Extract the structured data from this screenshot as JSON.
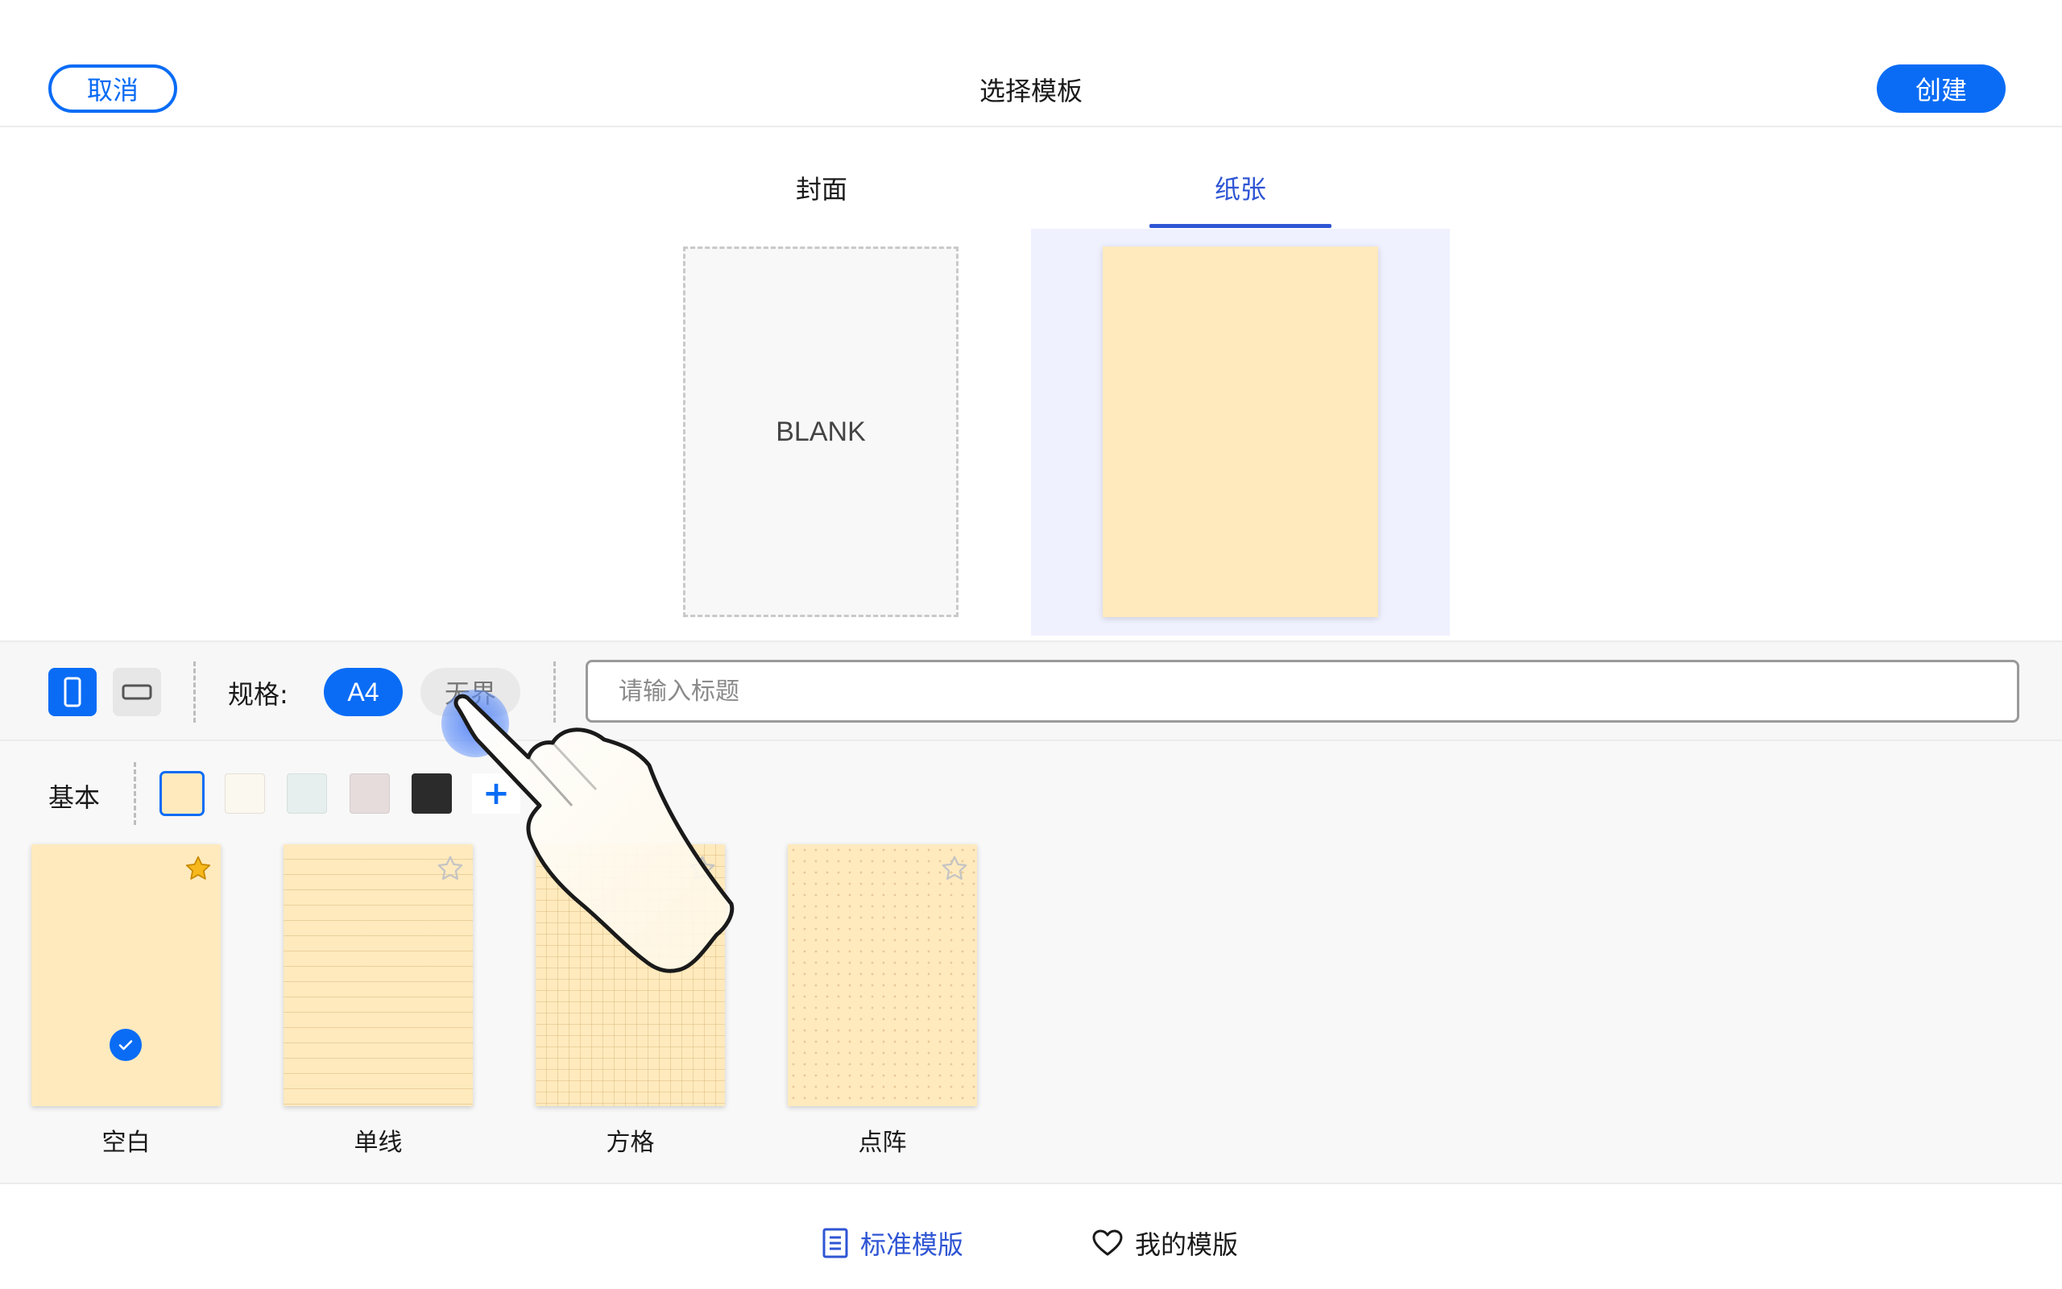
{
  "header": {
    "cancel_label": "取消",
    "title": "选择模板",
    "create_label": "创建"
  },
  "tabs": [
    {
      "label": "封面",
      "active": false
    },
    {
      "label": "纸张",
      "active": true
    }
  ],
  "preview": {
    "cover_text": "BLANK"
  },
  "toolbar": {
    "spec_label": "规格:",
    "sizes": [
      {
        "label": "A4",
        "selected": true
      },
      {
        "label": "无界",
        "selected": false
      }
    ],
    "title_placeholder": "请输入标题",
    "title_value": ""
  },
  "basic": {
    "label": "基本",
    "swatches": [
      "#ffeabe",
      "#fbf8f0",
      "#e6efee",
      "#e6dcdc",
      "#2b2b2b"
    ],
    "selected_swatch": 0,
    "add_label": "+",
    "templates": [
      {
        "label": "空白",
        "favorited": true,
        "selected": true
      },
      {
        "label": "单线",
        "favorited": false,
        "selected": false
      },
      {
        "label": "方格",
        "favorited": false,
        "selected": false
      },
      {
        "label": "点阵",
        "favorited": false,
        "selected": false
      }
    ]
  },
  "bottom_nav": [
    {
      "label": "标准模版",
      "icon": "document-list-icon",
      "active": true
    },
    {
      "label": "我的模版",
      "icon": "heart-icon",
      "active": false
    }
  ],
  "colors": {
    "accent": "#0a6cf5",
    "tab_active": "#2f55d4",
    "paper": "#ffeabe"
  }
}
